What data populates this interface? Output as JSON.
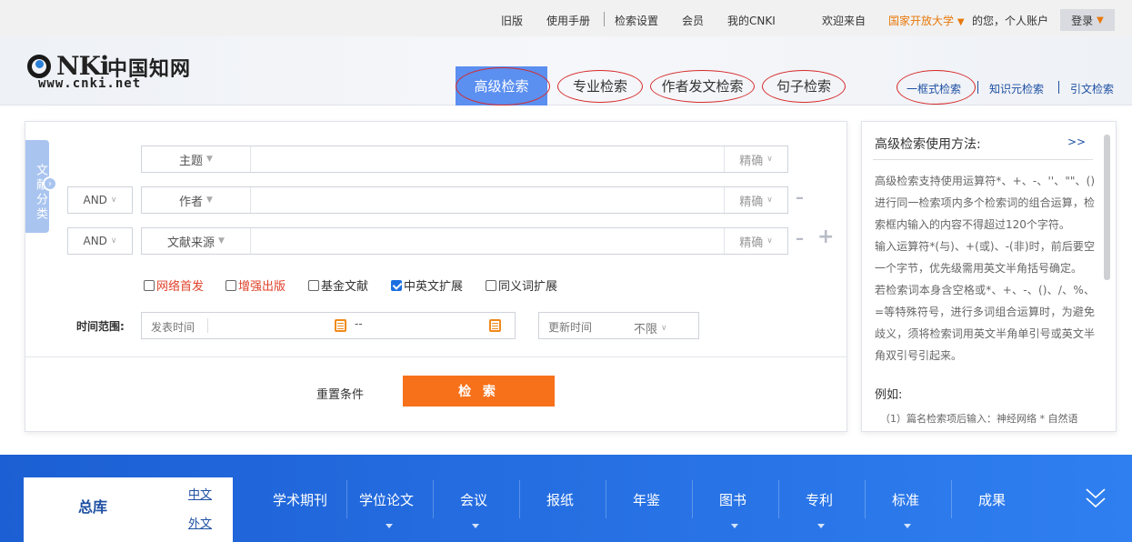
{
  "topbar": {
    "old_version": "旧版",
    "manual": "使用手册",
    "settings": "检索设置",
    "member": "会员",
    "my_cnki": "我的CNKI",
    "welcome": "欢迎来自",
    "org": "国家开放大学",
    "personal": "的您，个人账户",
    "login": "登录"
  },
  "logo": {
    "big": "CNKi",
    "cn": "中国知网",
    "sub": "www.cnki.net"
  },
  "tabs": [
    {
      "label": "高级检索",
      "active": true
    },
    {
      "label": "专业检索",
      "active": false
    },
    {
      "label": "作者发文检索",
      "active": false
    },
    {
      "label": "句子检索",
      "active": false
    }
  ],
  "right_tabs": [
    "一框式检索",
    "知识元检索",
    "引文检索"
  ],
  "side_tag": "文献分类",
  "search_rows": [
    {
      "op": "",
      "field": "主题",
      "value": "",
      "precision": "精确"
    },
    {
      "op": "AND",
      "field": "作者",
      "value": "",
      "precision": "精确"
    },
    {
      "op": "AND",
      "field": "文献来源",
      "value": "",
      "precision": "精确"
    }
  ],
  "checkboxes": [
    {
      "label": "网络首发",
      "checked": false,
      "red": true
    },
    {
      "label": "增强出版",
      "checked": false,
      "red": true
    },
    {
      "label": "基金文献",
      "checked": false,
      "red": false
    },
    {
      "label": "中英文扩展",
      "checked": true,
      "red": false
    },
    {
      "label": "同义词扩展",
      "checked": false,
      "red": false
    }
  ],
  "time": {
    "label": "时间范围:",
    "publish_label": "发表时间",
    "separator": "--",
    "update_label": "更新时间",
    "update_value": "不限"
  },
  "actions": {
    "reset": "重置条件",
    "search": "检 索"
  },
  "help": {
    "title": "高级检索使用方法:",
    "more": ">>",
    "para1": "高级检索支持使用运算符*、+、-、''、\"\"、()进行同一检索项内多个检索词的组合运算，检索框内输入的内容不得超过120个字符。",
    "para2": "输入运算符*(与)、+(或)、-(非)时，前后要空一个字节，优先级需用英文半角括号确定。",
    "para3": "若检索词本身含空格或*、+、-、()、/、%、=等特殊符号，进行多词组合运算时，为避免歧义，须将检索词用英文半角单引号或英文半角双引号引起来。",
    "example_title": "例如:",
    "example1": "（1）篇名检索项后输入：神经网络 * 自然语"
  },
  "bottom_nav": {
    "main": "总库",
    "zh": "中文",
    "wai": "外文",
    "items": [
      "学术期刊",
      "学位论文",
      "会议",
      "报纸",
      "年鉴",
      "图书",
      "专利",
      "标准",
      "成果"
    ]
  },
  "colors": {
    "accent": "#5b8ff0",
    "search_button": "#f6711a",
    "org_text": "#e8780a",
    "nav_blue": "#1c5fd4"
  }
}
